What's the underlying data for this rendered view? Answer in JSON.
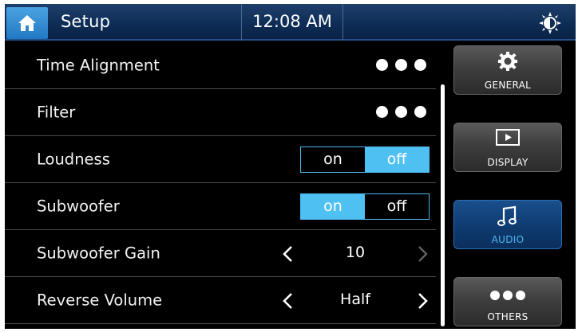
{
  "header": {
    "title": "Setup",
    "time": "12:08 AM",
    "home_icon": "home-icon",
    "brightness_icon": "brightness-icon"
  },
  "settings": {
    "time_alignment": {
      "label": "Time Alignment",
      "control": "more-dots"
    },
    "filter": {
      "label": "Filter",
      "control": "more-dots"
    },
    "loudness": {
      "label": "Loudness",
      "on": "on",
      "off": "off",
      "selected": "off"
    },
    "subwoofer": {
      "label": "Subwoofer",
      "on": "on",
      "off": "off",
      "selected": "on"
    },
    "subwoofer_gain": {
      "label": "Subwoofer Gain",
      "value": "10"
    },
    "reverse_volume": {
      "label": "Reverse Volume",
      "value": "Half"
    }
  },
  "sidebar": {
    "general": "GENERAL",
    "display": "DISPLAY",
    "audio": "AUDIO",
    "others": "OTHERS",
    "active": "AUDIO"
  },
  "colors": {
    "accent": "#4fc0f2",
    "header": "#0e2d57",
    "active_button": "#0f3c72"
  }
}
